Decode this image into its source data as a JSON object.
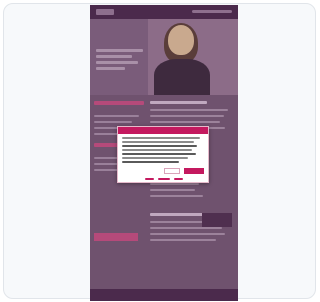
{
  "colors": {
    "overlay_tint": "#6a4d69",
    "brand_accent": "#c4195f",
    "header_bar": "#4b2a4c",
    "card_background": "#f7f9fb"
  },
  "icons": {
    "close": "close-icon"
  }
}
